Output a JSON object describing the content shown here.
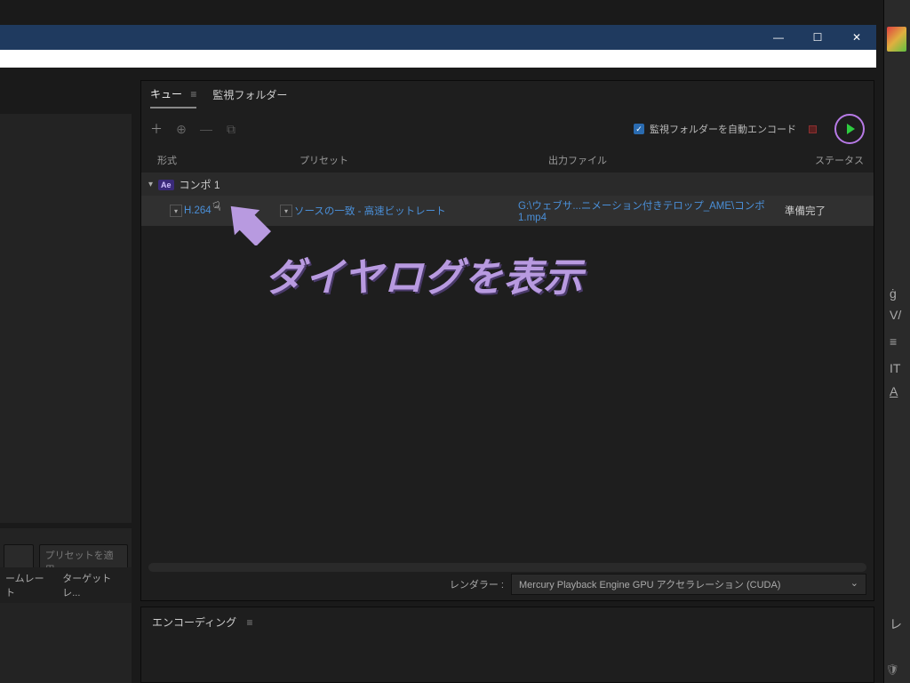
{
  "window": {
    "minimize": "—",
    "maximize": "☐",
    "close": "✕"
  },
  "tabs": {
    "queue": "キュー",
    "watch": "監視フォルダー"
  },
  "toolbar": {
    "auto_encode_label": "監視フォルダーを自動エンコード"
  },
  "headers": {
    "format": "形式",
    "preset": "プリセット",
    "output": "出力ファイル",
    "status": "ステータス"
  },
  "comp": {
    "badge": "Ae",
    "name": "コンポ 1"
  },
  "job": {
    "format": "H.264",
    "preset": "ソースの一致 - 高速ビットレート",
    "output": "G:\\ウェブサ...ニメーション付きテロップ_AME\\コンポ 1.mp4",
    "status": "準備完了"
  },
  "annotation": {
    "text": "ダイヤログを表示"
  },
  "renderer": {
    "label": "レンダラー :",
    "value": "Mercury Playback Engine GPU アクセラレーション (CUDA)"
  },
  "encoding_panel": {
    "title": "エンコーディング"
  },
  "left": {
    "apply_preset": "プリセットを適用",
    "framerate": "ームレート",
    "target": "ターゲットレ..."
  }
}
